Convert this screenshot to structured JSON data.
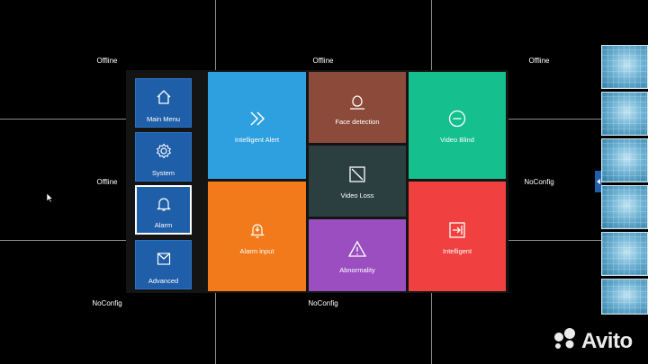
{
  "cameras": {
    "row1": [
      "Offline",
      "Offline",
      "Offline"
    ],
    "row2": [
      "Offline",
      "NoConfig"
    ],
    "row3": [
      "NoConfig",
      "NoConfig"
    ]
  },
  "sidebar": {
    "items": [
      {
        "label": "Main Menu",
        "icon": "home-icon"
      },
      {
        "label": "System",
        "icon": "gear-icon"
      },
      {
        "label": "Alarm",
        "icon": "bell-icon",
        "selected": true
      },
      {
        "label": "Advanced",
        "icon": "box-icon"
      }
    ]
  },
  "tiles": [
    {
      "label": "Intelligent Alert",
      "icon": "double-chevron-icon",
      "color": "#2ea0df"
    },
    {
      "label": "Face detection",
      "icon": "face-icon",
      "color": "#8b4a3a"
    },
    {
      "label": "Video Blind",
      "icon": "minus-circle-icon",
      "color": "#15c08e"
    },
    {
      "label": "Video Loss",
      "icon": "video-loss-icon",
      "color": "#2b3e40"
    },
    {
      "label": "Alarm input",
      "icon": "bell-down-icon",
      "color": "#f27a1a"
    },
    {
      "label": "Abnormality",
      "icon": "warning-icon",
      "color": "#9a4ec0"
    },
    {
      "label": "Intelligent",
      "icon": "exit-icon",
      "color": "#f04040"
    }
  ],
  "watermark": {
    "text": "Avito"
  },
  "colors": {
    "background": "#000000",
    "sidebar": "#1f5ea8",
    "panel": "#141414"
  }
}
